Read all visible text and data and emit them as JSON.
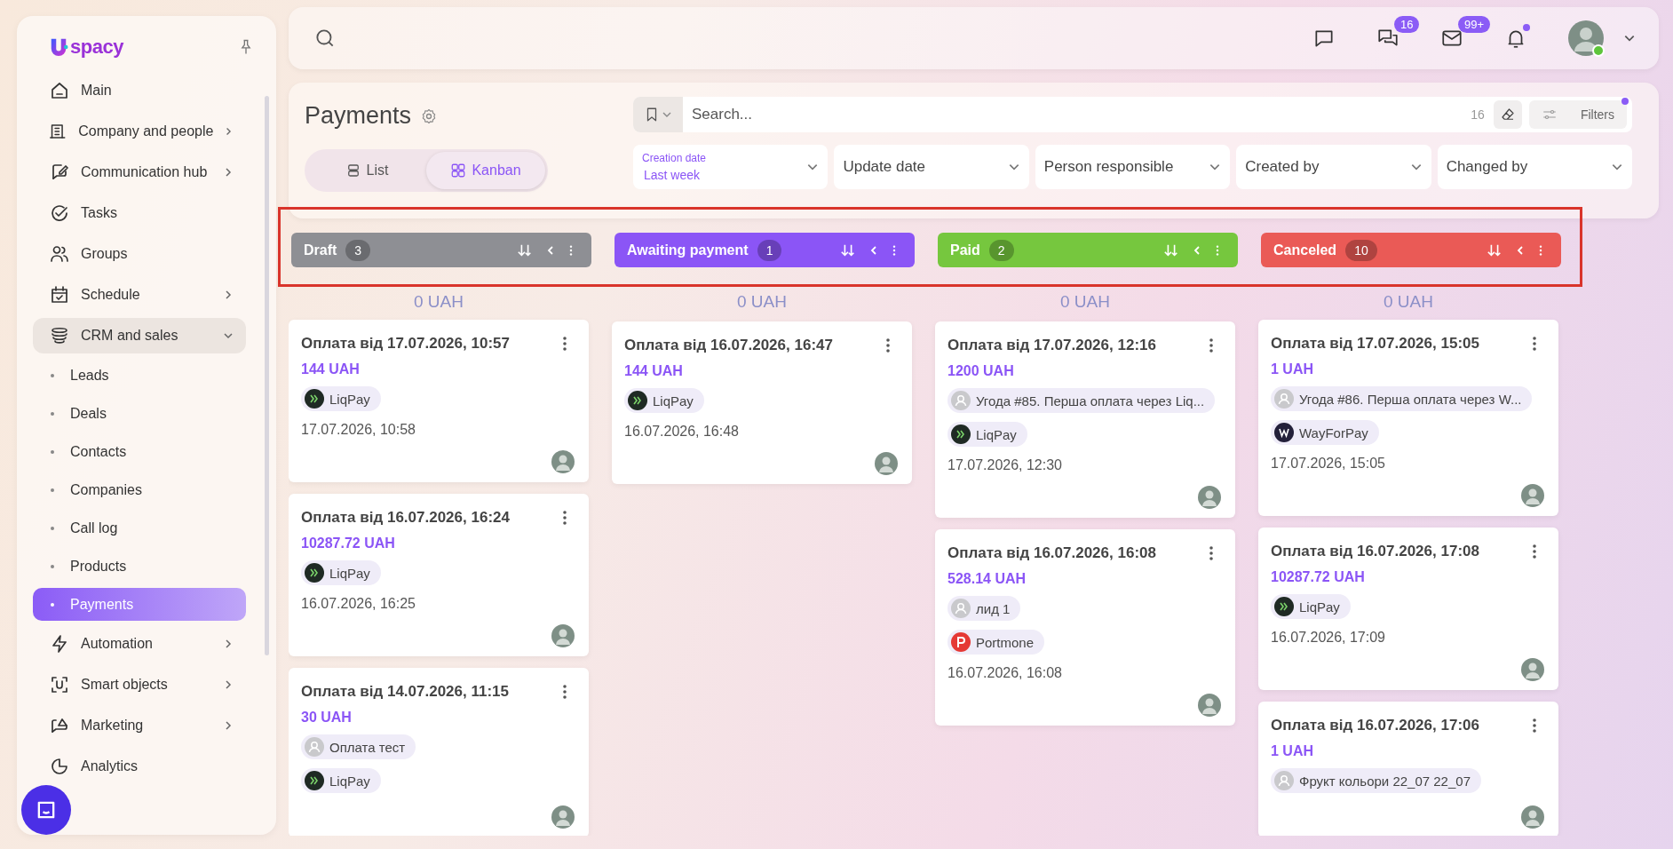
{
  "sidebar": {
    "logo": "spacy",
    "pinned": false,
    "items": [
      {
        "label": "Main",
        "expandable": false
      },
      {
        "label": "Company and people",
        "expandable": true
      },
      {
        "label": "Communication hub",
        "expandable": true
      },
      {
        "label": "Tasks",
        "expandable": false
      },
      {
        "label": "Groups",
        "expandable": false
      },
      {
        "label": "Schedule",
        "expandable": true
      },
      {
        "label": "CRM and sales",
        "expandable": true,
        "expanded": true,
        "children": [
          {
            "label": "Leads",
            "selected": false
          },
          {
            "label": "Deals",
            "selected": false
          },
          {
            "label": "Contacts",
            "selected": false
          },
          {
            "label": "Companies",
            "selected": false
          },
          {
            "label": "Call log",
            "selected": false
          },
          {
            "label": "Products",
            "selected": false
          },
          {
            "label": "Payments",
            "selected": true
          }
        ]
      },
      {
        "label": "Automation",
        "expandable": true
      },
      {
        "label": "Smart objects",
        "expandable": true
      },
      {
        "label": "Marketing",
        "expandable": true
      },
      {
        "label": "Analytics",
        "expandable": false
      }
    ]
  },
  "top_bar": {
    "chats_badge": "16",
    "mail_badge": "99+",
    "notifications_unread": true,
    "user_online": true
  },
  "page": {
    "title": "Payments",
    "view_toggle": [
      {
        "label": "List",
        "selected": false
      },
      {
        "label": "Kanban",
        "selected": true
      }
    ],
    "search": {
      "placeholder": "Search...",
      "count": "16"
    },
    "filters_button": {
      "label": "Filters",
      "active": true
    },
    "filter_fields": [
      {
        "label": "Creation date",
        "value": "Last week"
      },
      {
        "label": "Update date"
      },
      {
        "label": "Person responsible"
      },
      {
        "label": "Created by"
      },
      {
        "label": "Changed by"
      }
    ]
  },
  "kanban": {
    "headers_highlighted": true,
    "columns": [
      {
        "name": "Draft",
        "count": "3",
        "color": "#8e8f94",
        "total": "0 UAH",
        "cards": [
          {
            "title": "Оплата від 17.07.2026, 10:57",
            "amount": "144 UAH",
            "tags": [
              {
                "kind": "liqpay",
                "text": "LiqPay"
              }
            ],
            "date": "17.07.2026, 10:58"
          },
          {
            "title": "Оплата від 16.07.2026, 16:24",
            "amount": "10287.72 UAH",
            "tags": [
              {
                "kind": "liqpay",
                "text": "LiqPay"
              }
            ],
            "date": "16.07.2026, 16:25"
          },
          {
            "title": "Оплата від 14.07.2026, 11:15",
            "amount": "30 UAH",
            "tags": [
              {
                "kind": "contact",
                "text": "Оплата тест"
              },
              {
                "kind": "liqpay",
                "text": "LiqPay"
              }
            ]
          }
        ]
      },
      {
        "name": "Awaiting payment",
        "count": "1",
        "color": "#8b55f6",
        "total": "0 UAH",
        "cards": [
          {
            "title": "Оплата від 16.07.2026, 16:47",
            "amount": "144 UAH",
            "tags": [
              {
                "kind": "liqpay",
                "text": "LiqPay"
              }
            ],
            "date": "16.07.2026, 16:48"
          }
        ]
      },
      {
        "name": "Paid",
        "count": "2",
        "color": "#76c73e",
        "total": "0 UAH",
        "cards": [
          {
            "title": "Оплата від 17.07.2026, 12:16",
            "amount": "1200 UAH",
            "tags": [
              {
                "kind": "deal",
                "text": "Угода #85. Перша оплата через Liq..."
              },
              {
                "kind": "liqpay",
                "text": "LiqPay"
              }
            ],
            "date": "17.07.2026, 12:30"
          },
          {
            "title": "Оплата від 16.07.2026, 16:08",
            "amount": "528.14 UAH",
            "tags": [
              {
                "kind": "lead",
                "text": "лид 1"
              },
              {
                "kind": "portmone",
                "text": "Portmone"
              }
            ],
            "date": "16.07.2026, 16:08"
          }
        ]
      },
      {
        "name": "Canceled",
        "count": "10",
        "color": "#ea5a56",
        "total": "0 UAH",
        "cards": [
          {
            "title": "Оплата від 17.07.2026, 15:05",
            "amount": "1 UAH",
            "tags": [
              {
                "kind": "deal",
                "text": "Угода #86. Перша оплата через W..."
              },
              {
                "kind": "wayforpay",
                "text": "WayForPay"
              }
            ],
            "date": "17.07.2026, 15:05"
          },
          {
            "title": "Оплата від 16.07.2026, 17:08",
            "amount": "10287.72 UAH",
            "tags": [
              {
                "kind": "liqpay",
                "text": "LiqPay"
              }
            ],
            "date": "16.07.2026, 17:09"
          },
          {
            "title": "Оплата від 16.07.2026, 17:06",
            "amount": "1 UAH",
            "tags": [
              {
                "kind": "contact",
                "text": "Фрукт кольори 22_07 22_07"
              }
            ]
          }
        ]
      }
    ]
  }
}
